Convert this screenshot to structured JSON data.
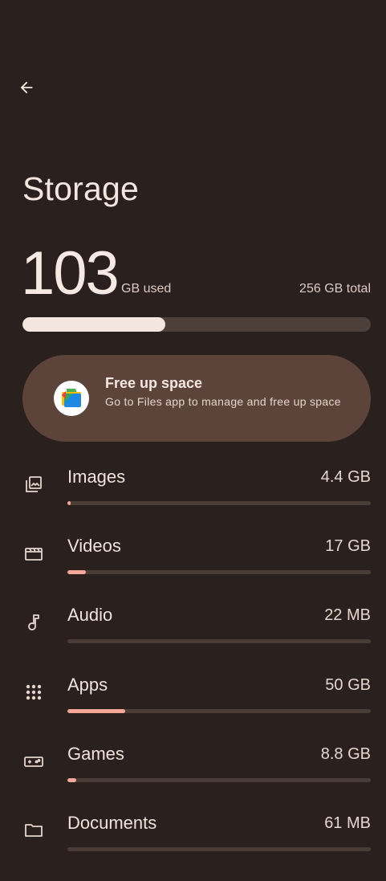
{
  "header": {
    "back_icon": "arrow-back-icon",
    "title": "Storage"
  },
  "summary": {
    "used_number": "103",
    "used_unit": "GB used",
    "total": "256 GB total",
    "used_fraction": 0.41
  },
  "free_up": {
    "icon": "files-app-icon",
    "title": "Free up space",
    "subtitle": "Go to Files app to manage and free up space"
  },
  "categories": [
    {
      "label": "Images",
      "value": "4.4 GB",
      "icon": "images-icon",
      "fraction": 0.01
    },
    {
      "label": "Videos",
      "value": "17 GB",
      "icon": "videos-icon",
      "fraction": 0.06
    },
    {
      "label": "Audio",
      "value": "22 MB",
      "icon": "music-note-icon",
      "fraction": 0.0
    },
    {
      "label": "Apps",
      "value": "50 GB",
      "icon": "apps-grid-icon",
      "fraction": 0.19
    },
    {
      "label": "Games",
      "value": "8.8 GB",
      "icon": "gamepad-icon",
      "fraction": 0.03
    },
    {
      "label": "Documents",
      "value": "61 MB",
      "icon": "folder-icon",
      "fraction": 0.0
    }
  ],
  "colors": {
    "background": "#2a201d",
    "card": "#5d443b",
    "accent": "#f5a898",
    "track": "#4a3d38"
  }
}
